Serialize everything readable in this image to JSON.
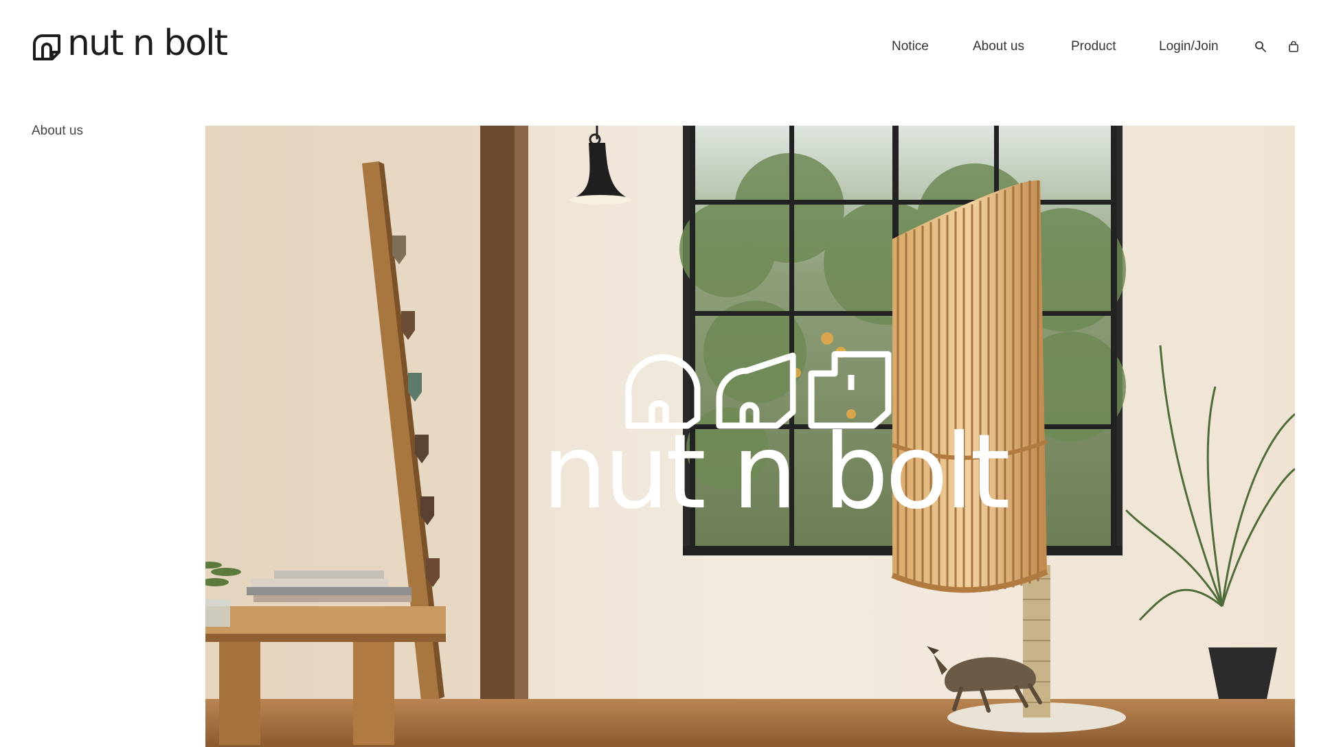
{
  "header": {
    "brand": {
      "wordmark": "nut n bolt",
      "icon": "house-logo-icon"
    },
    "nav": [
      {
        "label": "Notice"
      },
      {
        "label": "About us"
      },
      {
        "label": "Product"
      },
      {
        "label": "Login/Join"
      }
    ],
    "icons": {
      "search": "search-icon",
      "cart": "shopping-bag-icon"
    }
  },
  "side": {
    "label": "About us"
  },
  "hero": {
    "overlay_wordmark": "nut n bolt",
    "overlay_icons": [
      "house-arch-icon",
      "house-angled-icon",
      "house-square-icon"
    ],
    "image": "photo of cat tower with wooden slats, tabby cat, window and plant"
  },
  "colors": {
    "text": "#333333",
    "brand": "#1c1c1c",
    "background": "#ffffff",
    "wood": "#c49a64",
    "wall": "#efe6da"
  }
}
